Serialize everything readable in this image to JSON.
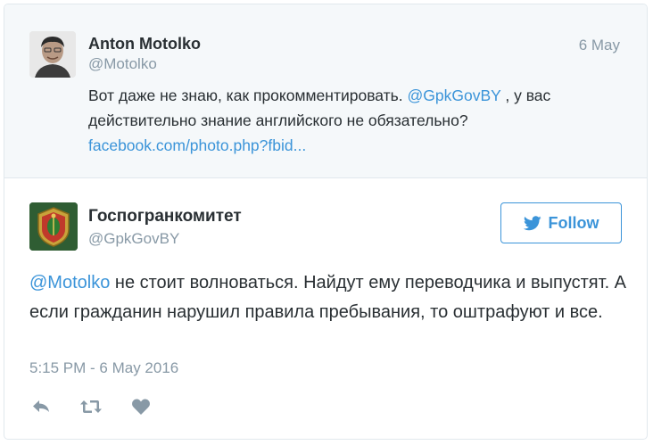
{
  "parent_tweet": {
    "author_name": "Anton Motolko",
    "author_handle": "@Motolko",
    "date": "6 May",
    "text_before": "Вот даже не знаю, как прокомментировать. ",
    "mention": "@GpkGovBY",
    "text_after": " , у вас действительно знание английского не обязательно?",
    "link": "facebook.com/photo.php?fbid..."
  },
  "reply_tweet": {
    "author_name": "Госпогранкомитет",
    "author_handle": "@GpkGovBY",
    "follow_label": "Follow",
    "mention": "@Motolko",
    "text": " не стоит волноваться. Найдут ему переводчика и выпустят. А если гражданин нарушил правила пребывания, то оштрафуют и все.",
    "timestamp": "5:15 PM - 6 May 2016"
  },
  "icons": {
    "reply": "reply-icon",
    "retweet": "retweet-icon",
    "like": "heart-icon",
    "follow": "twitter-bird-icon"
  },
  "colors": {
    "link": "#3b94d9",
    "muted": "#8899a6",
    "text": "#292f33",
    "parent_bg": "#f5f8fa"
  }
}
